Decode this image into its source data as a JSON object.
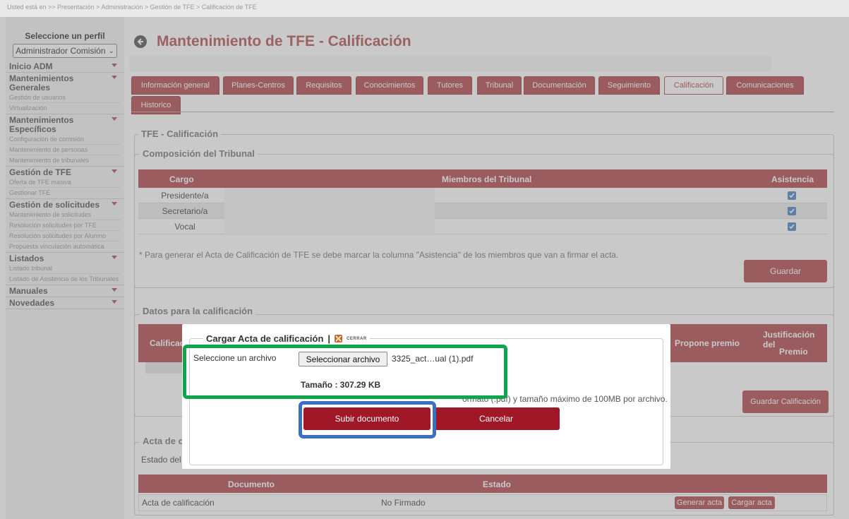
{
  "breadcrumb": "Usted está en >> Presentación > Administración > Gestión de TFE > Calificación de TFE",
  "sidebar": {
    "profile_label": "Seleccione un perfil",
    "profile_value": "Administrador Comisión",
    "groups": [
      {
        "title": "Inicio ADM",
        "items": []
      },
      {
        "title": "Mantenimientos Generales",
        "items": [
          "Gestión de usuarios",
          "Virtualización"
        ]
      },
      {
        "title": "Mantenimientos Específicos",
        "items": [
          "Configuración de comisión",
          "Mantenimiento de personas",
          "Mantenimiento de tribunales"
        ]
      },
      {
        "title": "Gestión de TFE",
        "items": [
          "Oferta de TFE masiva",
          "Gestionar TFE"
        ]
      },
      {
        "title": "Gestión de solicitudes",
        "items": [
          "Mantenimiento de solicitudes",
          "Resolución solicitudes por TFE",
          "Resolución solicitudes por Alumno",
          "Propuesta vinculación automática"
        ]
      },
      {
        "title": "Listados",
        "items": [
          "Listado tribunal",
          "Listado de Asistencia de los Tribunales"
        ]
      },
      {
        "title": "Manuales",
        "items": []
      },
      {
        "title": "Novedades",
        "items": []
      }
    ]
  },
  "header": {
    "title": "Mantenimiento de TFE - Calificación"
  },
  "tabs": [
    {
      "label": "Información general"
    },
    {
      "label": "Planes-Centros"
    },
    {
      "label": "Requisitos"
    },
    {
      "label": "Conocimientos"
    },
    {
      "label": "Tutores"
    },
    {
      "label": "Tribunal"
    },
    {
      "label": "Documentación"
    },
    {
      "label": "Seguimiento"
    },
    {
      "label": "Calificación"
    },
    {
      "label": "Comunicaciones"
    },
    {
      "label": "Historico"
    }
  ],
  "calificacion": {
    "legend": "TFE - Calificación",
    "tribunal": {
      "legend": "Composición del Tribunal",
      "columns": [
        "Cargo",
        "Miembros del Tribunal",
        "Asistencia"
      ],
      "rows": [
        {
          "cargo": "Presidente/a",
          "asistencia": true
        },
        {
          "cargo": "Secretario/a",
          "asistencia": true
        },
        {
          "cargo": "Vocal",
          "asistencia": true
        }
      ],
      "note": "* Para generar el Acta de Calificación de TFE se debe marcar la columna \"Asistencia\" de los miembros que van a firmar el acta.",
      "save_label": "Guardar"
    },
    "datos": {
      "legend": "Datos para la calificación",
      "col_calificacion": "Calificac",
      "col_premio": "Propone premio",
      "col_justificacion_1": "Justificación del",
      "col_justificacion_2": "Premio",
      "save_label": "Guardar Calificación"
    },
    "acta": {
      "legend": "Acta de c",
      "estado_label": "Estado del",
      "columns": [
        "Documento",
        "Estado"
      ],
      "row": {
        "documento": "Acta de calificación",
        "estado": "No Firmado"
      },
      "generar_label": "Generar acta",
      "cargar_label": "Cargar acta"
    }
  },
  "modal": {
    "title": "Cargar Acta de calificación",
    "separator": "|",
    "close_label": "CERRAR",
    "file_label": "Seleccione un archivo",
    "file_button": "Seleccionar archivo",
    "file_name": "3325_act…ual (1).pdf",
    "size": "Tamaño : 307.29 KB",
    "hint": "ormato (.pdf) y tamaño máximo de 100MB por archivo.",
    "upload_label": "Subir documento",
    "cancel_label": "Cancelar"
  },
  "colors": {
    "brand": "#b24a4f",
    "modal_button": "#a01827",
    "highlight_green": "#0fa54b",
    "highlight_blue": "#3a6fc4",
    "checkbox": "#4c84c8"
  }
}
